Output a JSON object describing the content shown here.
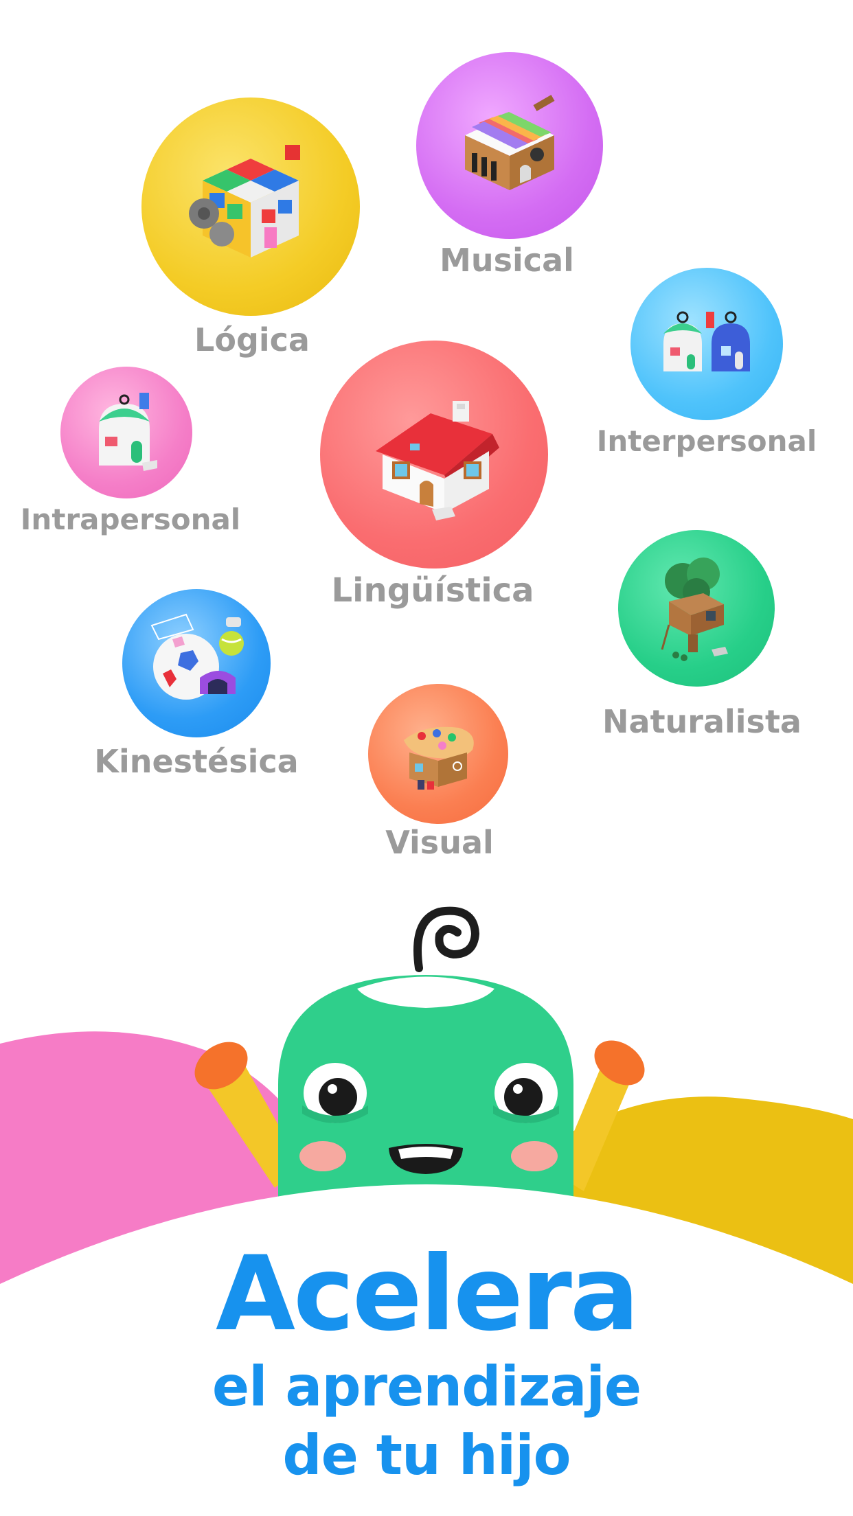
{
  "categories": [
    {
      "key": "logica",
      "label": "Lógica",
      "icon": "rubik-cube-house-icon",
      "color": "#f4cc26"
    },
    {
      "key": "musical",
      "label": "Musical",
      "icon": "xylophone-house-icon",
      "color": "#d46df3"
    },
    {
      "key": "interpersonal",
      "label": "Interpersonal",
      "icon": "twin-houses-icon",
      "color": "#4fc3fb"
    },
    {
      "key": "intrapersonal",
      "label": "Intrapersonal",
      "icon": "single-hut-icon",
      "color": "#f57fc8"
    },
    {
      "key": "linguistica",
      "label": "Lingüística",
      "icon": "red-roof-house-icon",
      "color": "#fa6d70"
    },
    {
      "key": "naturalista",
      "label": "Naturalista",
      "icon": "tree-house-icon",
      "color": "#27cf89"
    },
    {
      "key": "kinestesica",
      "label": "Kinestésica",
      "icon": "soccer-ball-house-icon",
      "color": "#2d9cf6"
    },
    {
      "key": "visual",
      "label": "Visual",
      "icon": "paint-palette-house-icon",
      "color": "#fb7f52"
    }
  ],
  "mascot": {
    "icon": "green-monster-mascot-icon",
    "color": "#2fcf8b"
  },
  "headline": {
    "line1": "Acelera",
    "line2": "el aprendizaje",
    "line3": "de tu hijo",
    "color": "#1792ee"
  },
  "background_colors": {
    "pink_hill": "#f67cc6",
    "yellow_hill": "#ebc013"
  }
}
